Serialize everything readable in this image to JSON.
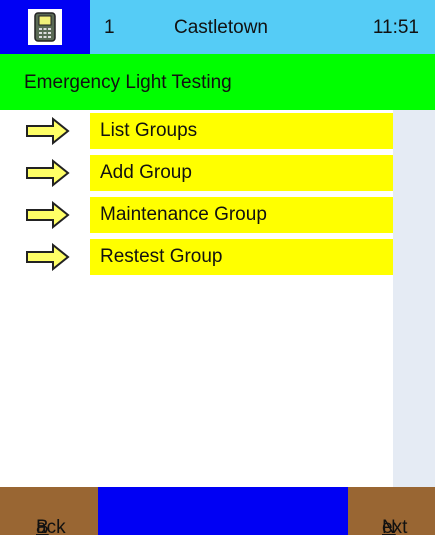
{
  "status_bar": {
    "device_icon": "handheld-device-icon",
    "count": "1",
    "location": "Castletown",
    "time": "11:51"
  },
  "title": "Emergency Light Testing",
  "menu": {
    "arrow_icon": "right-arrow-icon",
    "items": [
      {
        "label": "List Groups"
      },
      {
        "label": "Add Group"
      },
      {
        "label": "Maintenance Group"
      },
      {
        "label": "Restest Group"
      }
    ]
  },
  "softkeys": {
    "back": {
      "accel": "B",
      "rest": "ack"
    },
    "next": {
      "accel": "N",
      "rest": "ext"
    }
  },
  "colors": {
    "status_bar": "#55ccf6",
    "icon_bg": "#0000f4",
    "title_bar": "#00ff00",
    "menu_item": "#ffff00",
    "softkey": "#996633",
    "arrow_fill": "#ffff66"
  }
}
